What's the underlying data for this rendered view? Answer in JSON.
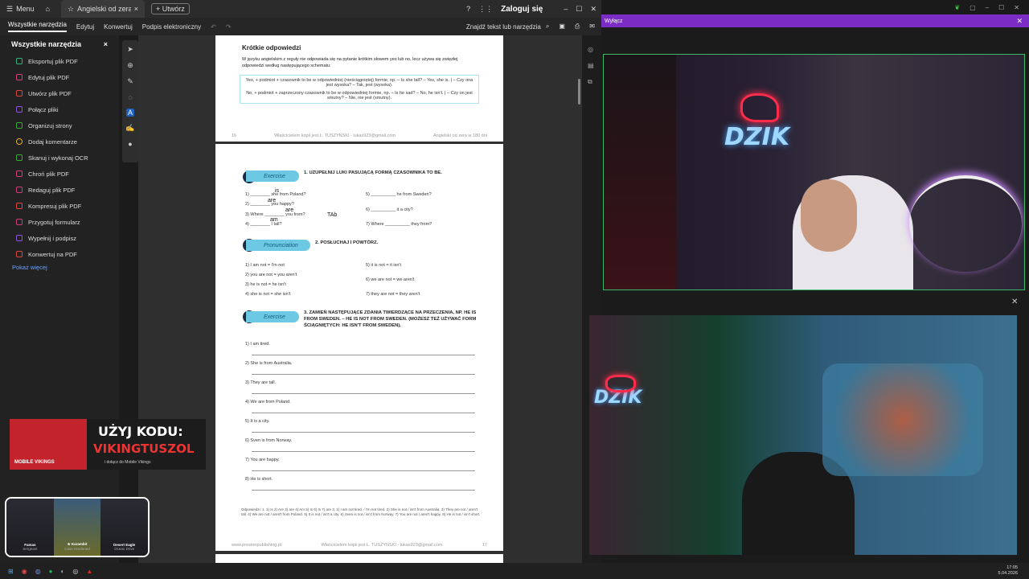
{
  "titlebar": {
    "menu_label": "Menu",
    "tab_title": "Angielski od zera w ...",
    "new_tab_label": "Utwórz",
    "login_label": "Zaloguj się"
  },
  "menubar": {
    "items": [
      "Wszystkie narzędzia",
      "Edytuj",
      "Konwertuj",
      "Podpis elektroniczny"
    ],
    "search_label": "Znajdź tekst lub narzędzia"
  },
  "leftpanel": {
    "title": "Wszystkie narzędzia",
    "items": [
      {
        "label": "Eksportuj plik PDF",
        "color": "#2fb67c"
      },
      {
        "label": "Edytuj plik PDF",
        "color": "#d23d7a"
      },
      {
        "label": "Utwórz plik PDF",
        "color": "#e0443e"
      },
      {
        "label": "Połącz pliki",
        "color": "#8a54d6"
      },
      {
        "label": "Organizuj strony",
        "color": "#3aaa35"
      },
      {
        "label": "Dodaj komentarze",
        "color": "#e8b21c"
      },
      {
        "label": "Skanuj i wykonaj OCR",
        "color": "#3aaa35"
      },
      {
        "label": "Chroń plik PDF",
        "color": "#d23d7a"
      },
      {
        "label": "Redaguj plik PDF",
        "color": "#d23d7a"
      },
      {
        "label": "Kompresuj plik PDF",
        "color": "#e0443e"
      },
      {
        "label": "Przygotuj formularz",
        "color": "#d23d7a"
      },
      {
        "label": "Wypełnij i podpisz",
        "color": "#8a54d6"
      },
      {
        "label": "Konwertuj na PDF",
        "color": "#e0443e"
      }
    ],
    "more_label": "Pokaż więcej"
  },
  "page1": {
    "heading": "Krótkie odpowiedzi",
    "intro": "W języku angielskim z reguły nie odpowiada się na pytanie krótkim słowem yes lub no, lecz używa się zwięzłej odpowiedzi według następującego schematu:",
    "rule_yes": "Yes, + podmiot + czasownik to be w odpowiedniej (nieściągniętej) formie, np. – Is she tall? – Yes, she is. | – Czy ona jest wysoka? – Tak, jest (wysoka).",
    "rule_no": "No, + podmiot + zaprzeczony czasownik to be w odpowiedniej formie, np. – Is he sad? – No, he isn't. | – Czy on jest smutny? – Nie, nie jest (smutny).",
    "footer_left": "16",
    "footer_mid": "Właścicielem kopii jest Ł. TUSZYŃSKI - lukas923@gmail.com",
    "footer_right": "Angielski od zera w 180 dni"
  },
  "page2": {
    "exercise_badge": "Exercise",
    "pronunciation_badge": "Pronunciation",
    "sec1_title": "1.   UZUPEŁNIJ LUKI PASUJĄCĄ FORMĄ CZASOWNIKA TO BE.",
    "sec1_items_left": [
      "1)  ________ she from Poland?",
      "2)  ________ you happy?",
      "3)  Where ________ you from?",
      "4)  ________ I tall?"
    ],
    "sec1_items_right": [
      "5)  __________ he from Sweden?",
      "6)  __________ it a city?",
      "7)  Where __________ they from?"
    ],
    "handwritten": [
      "is",
      "are",
      "are",
      "am",
      "TAb"
    ],
    "sec2_title": "2.   POSŁUCHAJ I POWTÓRZ.",
    "sec2_left": [
      "1)  I am not = I'm not",
      "2)  you are not = you aren't",
      "3)  he is not = he isn't",
      "4)  she is not = she isn't"
    ],
    "sec2_right": [
      "5)  it is not = it isn't",
      "6)  we are not = we aren't",
      "7)  they are not = they aren't"
    ],
    "sec3_title": "3.   ZAMIEŃ NASTĘPUJĄCE ZDANIA TWIERDZĄCE NA PRZECZENIA, NP. HE IS FROM SWEDEN. – HE IS NOT FROM SWEDEN. (MOŻESZ TEŻ UŻYWAĆ FORM ŚCIĄGNIĘTYCH: HE ISN'T FROM SWEDEN).",
    "sec3_items": [
      "1)  I am tired.",
      "2)  She is from Australia.",
      "3)  They are tall.",
      "4)  We are from Poland.",
      "5)  It is a city.",
      "6)  Sven is from Norway.",
      "7)  You are happy.",
      "8)  He is short."
    ],
    "answers": "Odpowiedzi: 1. 1) Is 2) Are 3) are 4) Am 5) Is 6) Is 7) are 3. 1) I am not tired. / I'm not tired. 2) She is not / isn't from Australia. 3) They are not / aren't tall. 4) We are not / aren't from Poland. 5) It is not / isn't a city. 6) Sven is not / isn't from Norway. 7) You are not / aren't happy. 8) He is not / isn't short.",
    "footer_left": "www.prestonpublishing.pl",
    "footer_mid": "Właścicielem kopii jest Ł. TUSZYŃSKI - lukas923@gmail.com",
    "footer_right": "17"
  },
  "stream": {
    "notify_text": "Wyłącz",
    "neon_text": "DZIK"
  },
  "promo": {
    "brand": "MOBILE VIKINGS",
    "line1": "UŻYJ KODU:",
    "code": "VIKINGTUSZOL",
    "sub": "i dołącz do Mobile Vikings"
  },
  "skins": [
    {
      "name": "Famas",
      "sub": "Sergeant"
    },
    {
      "name": "★ Karambit",
      "sub": "Case Hardened"
    },
    {
      "name": "Desert Eagle",
      "sub": "Ocean Drive"
    }
  ],
  "taskbar": {
    "time": "17:05",
    "date": "5.04.2026"
  }
}
